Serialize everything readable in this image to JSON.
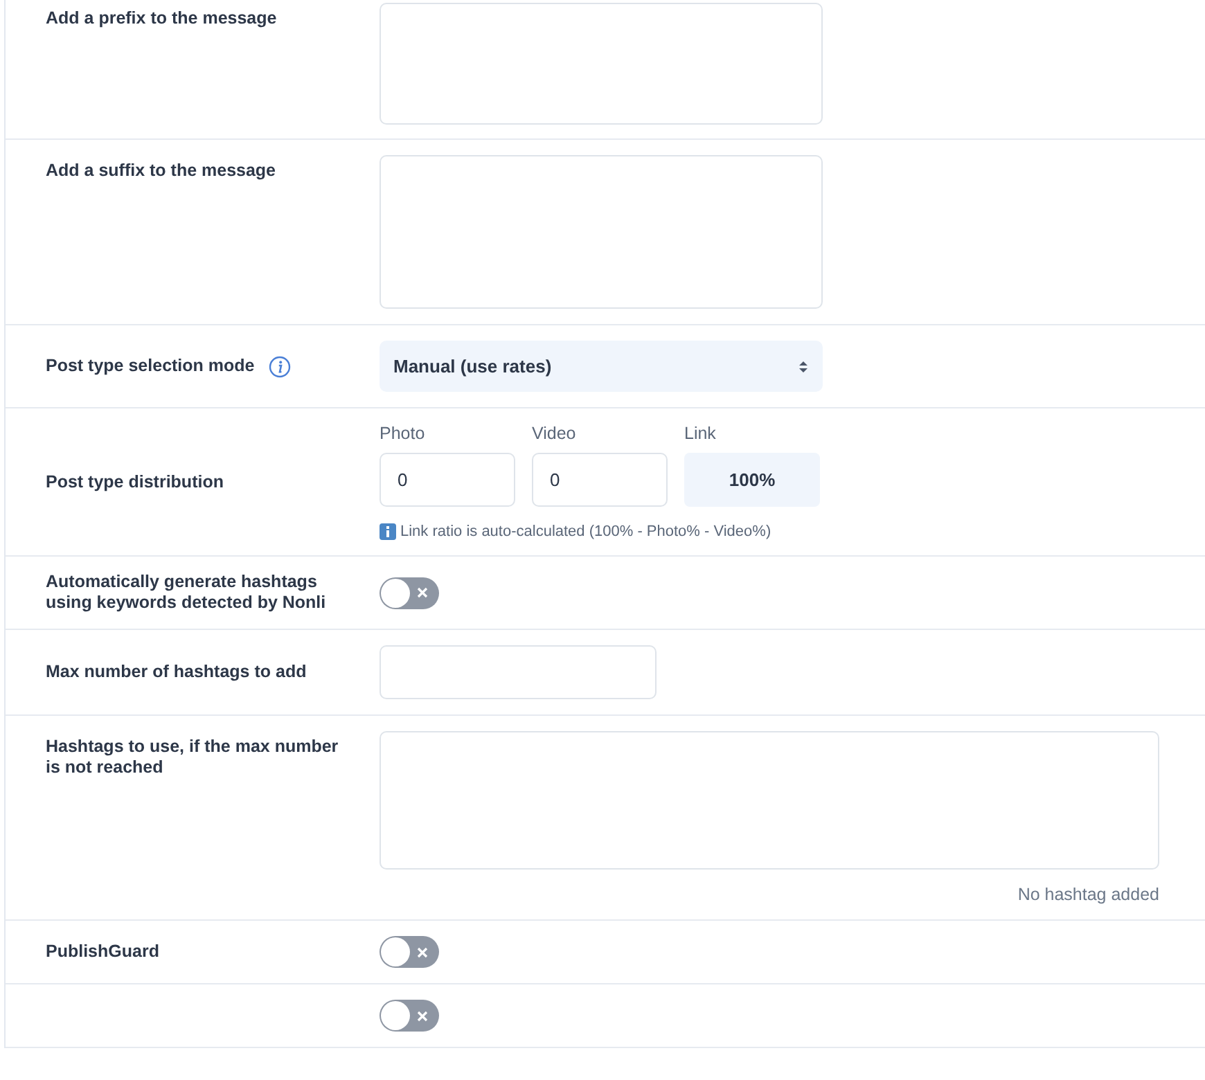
{
  "rows": [
    {
      "kind": "textarea",
      "label": "Add a prefix to the message"
    },
    {
      "kind": "textarea",
      "label": "Add a suffix to the message"
    },
    {
      "kind": "select",
      "label": "Post type selection mode",
      "info": true,
      "value": "Manual (use rates)"
    },
    {
      "kind": "distribution",
      "label": "Post type distribution",
      "fields": [
        {
          "kind": "input",
          "label": "Photo",
          "value": "0"
        },
        {
          "kind": "input",
          "label": "Video",
          "value": "0"
        },
        {
          "kind": "readout",
          "label": "Link",
          "value": "100%"
        }
      ],
      "note": "Link ratio is auto-calculated (100% - Photo% - Video%)"
    },
    {
      "kind": "toggle",
      "label": "Automatically generate hashtags using keywords detected by Nonli",
      "on": false
    },
    {
      "kind": "input",
      "label": "Max number of hashtags to add"
    },
    {
      "kind": "tagarea",
      "label": "Hashtags to use, if the max number is not reached",
      "note": "No hashtag added"
    },
    {
      "kind": "toggle",
      "label": "PublishGuard",
      "on": false
    },
    {
      "kind": "toggle",
      "on": false
    }
  ]
}
